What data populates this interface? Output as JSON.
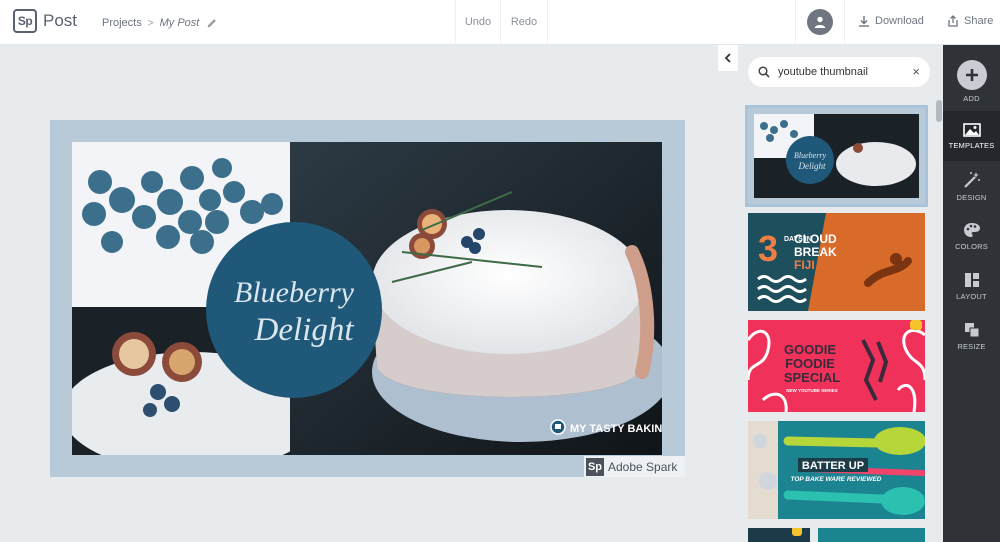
{
  "app": {
    "logo_mark": "Sp",
    "name": "Post"
  },
  "breadcrumb": {
    "projects": "Projects",
    "separator": ">",
    "current": "My Post"
  },
  "toolbar": {
    "undo": "Undo",
    "redo": "Redo",
    "download": "Download",
    "share": "Share"
  },
  "canvas": {
    "title_line1": "Blueberry",
    "title_line2": "Delight",
    "channel": "MY TASTY BAKING",
    "watermark_mark": "Sp",
    "watermark_text": "Adobe Spark"
  },
  "search": {
    "value": "youtube thumbnail",
    "placeholder": "Search",
    "clear": "×"
  },
  "templates": [
    {
      "name": "blueberry-delight-template",
      "selected": true
    },
    {
      "name": "cloud-break-fiji-template",
      "line1": "3",
      "line2": "DAYS IN",
      "line3": "CLOUD",
      "line4": "BREAK",
      "line5": "FIJI"
    },
    {
      "name": "goodie-foodie-template",
      "line1": "GOODIE",
      "line2": "FOODIE",
      "line3": "SPECIAL",
      "line4": "NEW YOUTUBE SERIES"
    },
    {
      "name": "batter-up-template",
      "line1": "BATTER UP",
      "line2": "TOP BAKE WARE REVIEWED"
    }
  ],
  "rail": [
    {
      "label": "ADD",
      "icon": "plus-icon"
    },
    {
      "label": "TEMPLATES",
      "icon": "image-icon"
    },
    {
      "label": "DESIGN",
      "icon": "magic-wand-icon"
    },
    {
      "label": "COLORS",
      "icon": "palette-icon"
    },
    {
      "label": "LAYOUT",
      "icon": "layout-icon"
    },
    {
      "label": "RESIZE",
      "icon": "resize-icon"
    }
  ],
  "colors": {
    "accent_circle": "#1f5878",
    "frame": "#b8c9d8",
    "rail": "#2f3338",
    "pink": "#f0325a",
    "teal": "#1e5a68",
    "orange": "#d86a2a"
  }
}
